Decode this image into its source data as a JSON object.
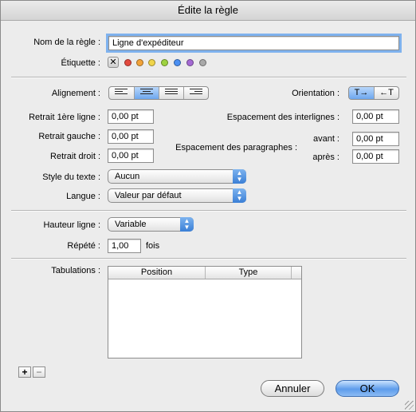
{
  "window": {
    "title": "Édite la règle"
  },
  "fields": {
    "nom_label": "Nom de la règle :",
    "nom_value": "Ligne d'expéditeur",
    "etiquette_label": "Étiquette :",
    "etiquette_colors": [
      "#e2493e",
      "#f2a33a",
      "#f0d54a",
      "#9dd23f",
      "#4a8ff2",
      "#a46ad3",
      "#a9a9a9"
    ],
    "alignement_label": "Alignement :",
    "orientation_label": "Orientation :",
    "orientation_ltr": "T→",
    "orientation_rtl": "←T",
    "retrait_premiere_label": "Retrait 1ère ligne :",
    "retrait_premiere_value": "0,00 pt",
    "retrait_gauche_label": "Retrait gauche :",
    "retrait_gauche_value": "0,00 pt",
    "retrait_droit_label": "Retrait droit :",
    "retrait_droit_value": "0,00 pt",
    "interlignes_label": "Espacement des interlignes :",
    "interlignes_value": "0,00 pt",
    "paragraphes_label": "Espacement des paragraphes :",
    "avant_label": "avant :",
    "avant_value": "0,00 pt",
    "apres_label": "après :",
    "apres_value": "0,00 pt",
    "style_label": "Style du texte :",
    "style_value": "Aucun",
    "langue_label": "Langue :",
    "langue_value": "Valeur par défaut",
    "hauteur_label": "Hauteur ligne :",
    "hauteur_value": "Variable",
    "repete_label": "Répété :",
    "repete_value": "1,00",
    "repete_unit": "fois",
    "tabulations_label": "Tabulations :",
    "tab_columns": [
      "Position",
      "Type"
    ]
  },
  "footer": {
    "add_label": "+",
    "remove_label": "−",
    "cancel_label": "Annuler",
    "ok_label": "OK"
  },
  "colors": {
    "accent": "#5d9ceb",
    "focus_ring": "#7fb2ee"
  }
}
